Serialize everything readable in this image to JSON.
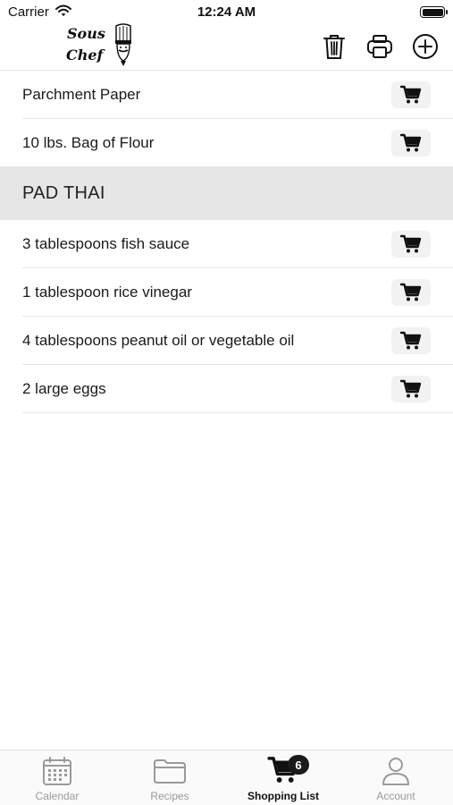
{
  "status_bar": {
    "carrier": "Carrier",
    "time": "12:24 AM"
  },
  "header": {
    "logo_line1": "Sous",
    "logo_line2": "Chef",
    "icons": [
      "trash-icon",
      "printer-icon",
      "plus-circle-icon"
    ]
  },
  "list": {
    "top_items": [
      {
        "label": "Parchment Paper"
      },
      {
        "label": "10 lbs. Bag of Flour"
      }
    ],
    "section": {
      "title": "PAD THAI",
      "items": [
        {
          "label": "3 tablespoons fish sauce"
        },
        {
          "label": "1 tablespoon rice vinegar"
        },
        {
          "label": "4 tablespoons peanut oil or vegetable oil"
        },
        {
          "label": "2 large eggs"
        }
      ]
    }
  },
  "tab_bar": {
    "tabs": [
      {
        "label": "Calendar",
        "icon": "calendar-icon"
      },
      {
        "label": "Recipes",
        "icon": "folder-icon"
      },
      {
        "label": "Shopping List",
        "icon": "cart-icon",
        "badge": "6",
        "active": true
      },
      {
        "label": "Account",
        "icon": "person-icon"
      }
    ]
  },
  "colors": {
    "accent": "#111111",
    "section_bg": "#e6e6e6",
    "inactive_tab": "#9a9a9a"
  }
}
